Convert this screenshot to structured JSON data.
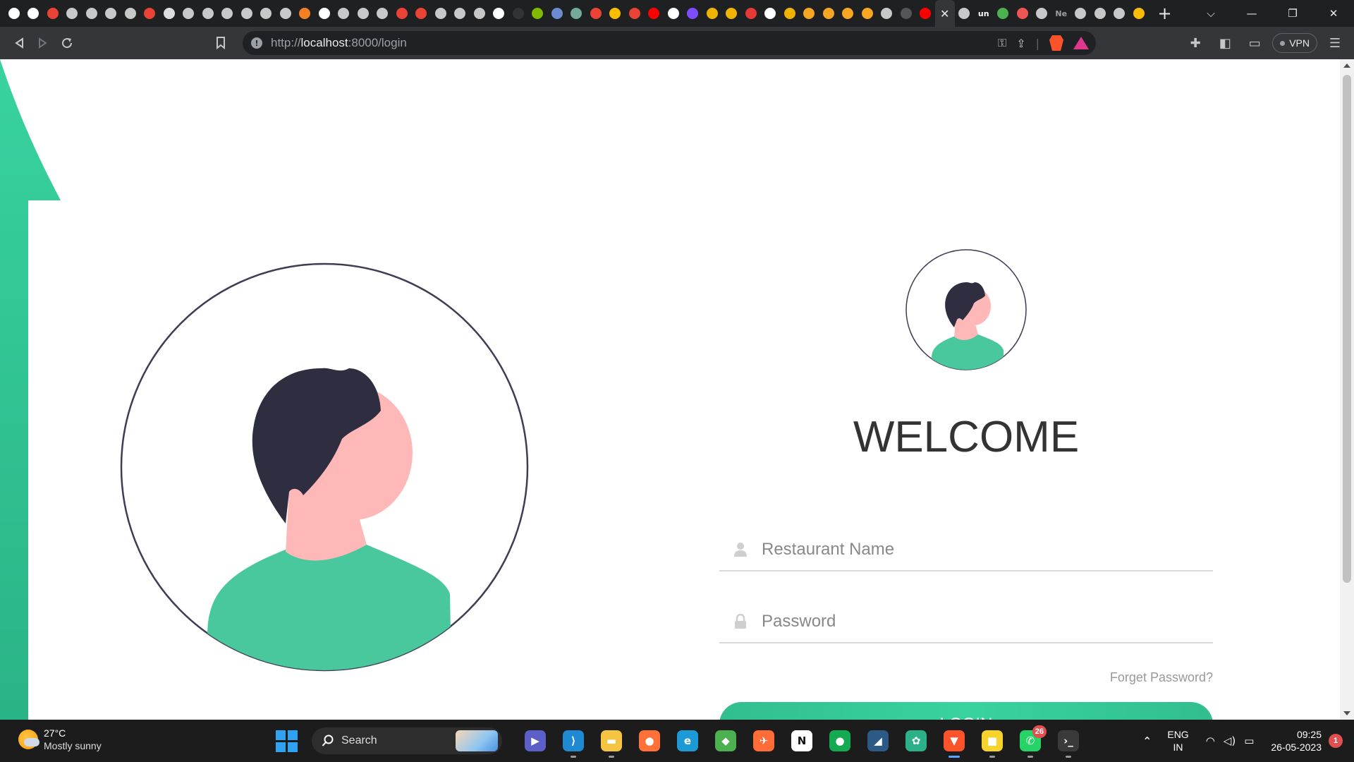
{
  "browser": {
    "tabs_favicons": [
      {
        "icon": "github-icon",
        "color": "#ffffff"
      },
      {
        "icon": "github-icon",
        "color": "#ffffff"
      },
      {
        "icon": "google-icon",
        "color": "#ea4335"
      },
      {
        "icon": "globe-icon",
        "color": "#c8c8c8"
      },
      {
        "icon": "globe-icon",
        "color": "#c8c8c8"
      },
      {
        "icon": "globe-icon",
        "color": "#c8c8c8"
      },
      {
        "icon": "globe-icon",
        "color": "#c8c8c8"
      },
      {
        "icon": "google-icon",
        "color": "#ea4335"
      },
      {
        "icon": "crown-icon",
        "color": "#dddddd"
      },
      {
        "icon": "globe-icon",
        "color": "#c8c8c8"
      },
      {
        "icon": "globe-icon",
        "color": "#c8c8c8"
      },
      {
        "icon": "globe-icon",
        "color": "#c8c8c8"
      },
      {
        "icon": "globe-icon",
        "color": "#c8c8c8"
      },
      {
        "icon": "globe-icon",
        "color": "#c8c8c8"
      },
      {
        "icon": "globe-icon",
        "color": "#c8c8c8"
      },
      {
        "icon": "stackoverflow-icon",
        "color": "#f48024"
      },
      {
        "icon": "github-icon",
        "color": "#ffffff"
      },
      {
        "icon": "globe-icon",
        "color": "#c8c8c8"
      },
      {
        "icon": "globe-icon",
        "color": "#c8c8c8"
      },
      {
        "icon": "globe-icon",
        "color": "#c8c8c8"
      },
      {
        "icon": "google-icon",
        "color": "#ea4335"
      },
      {
        "icon": "google-icon",
        "color": "#ea4335"
      },
      {
        "icon": "globe-icon",
        "color": "#c8c8c8"
      },
      {
        "icon": "globe-icon",
        "color": "#c8c8c8"
      },
      {
        "icon": "globe-icon",
        "color": "#c8c8c8"
      },
      {
        "icon": "github-icon",
        "color": "#ffffff"
      },
      {
        "icon": "dark-page-icon",
        "color": "#333333"
      },
      {
        "icon": "microsoft-icon",
        "color": "#7fba00"
      },
      {
        "icon": "image-icon",
        "color": "#6b8cce"
      },
      {
        "icon": "chatgpt-icon",
        "color": "#74aa9c"
      },
      {
        "icon": "google-icon",
        "color": "#ea4335"
      },
      {
        "icon": "drive-icon",
        "color": "#fbbc04"
      },
      {
        "icon": "google-icon",
        "color": "#ea4335"
      },
      {
        "icon": "youtube-icon",
        "color": "#ff0000"
      },
      {
        "icon": "history-icon",
        "color": "#ffffff"
      },
      {
        "icon": "list-icon",
        "color": "#7c4dff"
      },
      {
        "icon": "code-icon",
        "color": "#f0b400"
      },
      {
        "icon": "code-icon",
        "color": "#f0b400"
      },
      {
        "icon": "play-outline-icon",
        "color": "#e53935"
      },
      {
        "icon": "github-icon",
        "color": "#ffffff"
      },
      {
        "icon": "code-icon",
        "color": "#f0b400"
      },
      {
        "icon": "sun-icon",
        "color": "#f5a623"
      },
      {
        "icon": "sun-icon",
        "color": "#f5a623"
      },
      {
        "icon": "sun-icon",
        "color": "#f5a623"
      },
      {
        "icon": "sun-icon",
        "color": "#f5a623"
      },
      {
        "icon": "globe-icon",
        "color": "#c8c8c8"
      },
      {
        "icon": "circle-icon",
        "color": "#555555"
      },
      {
        "icon": "youtube-icon",
        "color": "#ff0000"
      },
      {
        "icon": "close-icon",
        "color": "#e8eaed",
        "active": true
      },
      {
        "icon": "globe-icon",
        "color": "#c8c8c8"
      },
      {
        "icon": "unstop-icon",
        "color": "#ffffff",
        "text": "un"
      },
      {
        "icon": "puzzle-icon",
        "color": "#4caf50"
      },
      {
        "icon": "figma-icon",
        "color": "#e55"
      },
      {
        "icon": "globe-icon",
        "color": "#c8c8c8"
      },
      {
        "icon": "notion-icon",
        "color": "#9aa0a6",
        "text": "Ne"
      },
      {
        "icon": "globe-icon",
        "color": "#c8c8c8"
      },
      {
        "icon": "globe-icon",
        "color": "#c8c8c8"
      },
      {
        "icon": "globe-icon",
        "color": "#c8c8c8"
      },
      {
        "icon": "slides-icon",
        "color": "#fbbc04"
      }
    ],
    "new_tab_label": "+",
    "window_controls": {
      "list": "⌵",
      "minimize": "—",
      "restore": "❐",
      "close": "✕"
    },
    "url_prefix": "http://",
    "url_host": "localhost",
    "url_rest": ":8000/login",
    "vpn_label": "VPN"
  },
  "page": {
    "welcome": "WELCOME",
    "username_placeholder": "Restaurant Name",
    "password_placeholder": "Password",
    "forgot_label": "Forget Password?",
    "login_label": "LOGIN",
    "colors": {
      "accent": "#38d39f",
      "accent_dark": "#32be8f",
      "hair": "#2f2e41",
      "skin": "#ffb8b8",
      "shirt": "#48c89c"
    }
  },
  "taskbar": {
    "weather_temp": "27°C",
    "weather_cond": "Mostly sunny",
    "search_label": "Search",
    "apps": [
      {
        "name": "teams-app",
        "icon": "teams-icon",
        "bg": "#5b5fc7",
        "glyph": "▶"
      },
      {
        "name": "vscode-app",
        "icon": "vscode-icon",
        "bg": "#1f8ad2",
        "glyph": "⟩",
        "pip": true
      },
      {
        "name": "explorer-app",
        "icon": "folder-icon",
        "bg": "#f5c542",
        "glyph": "▬",
        "pip": true
      },
      {
        "name": "firefox-app",
        "icon": "firefox-icon",
        "bg": "#ff7139",
        "glyph": "●"
      },
      {
        "name": "edge-app",
        "icon": "edge-icon",
        "bg": "#1c9ad6",
        "glyph": "e"
      },
      {
        "name": "git-app",
        "icon": "git-icon",
        "bg": "#4caf50",
        "glyph": "◆"
      },
      {
        "name": "postman-app",
        "icon": "postman-icon",
        "bg": "#ff6c37",
        "glyph": "✈"
      },
      {
        "name": "notion-app",
        "icon": "notion-icon",
        "bg": "#ffffff",
        "glyph": "N"
      },
      {
        "name": "mongodb-app",
        "icon": "mongodb-icon",
        "bg": "#13aa52",
        "glyph": "●"
      },
      {
        "name": "mysql-app",
        "icon": "mysql-icon",
        "bg": "#2c5a85",
        "glyph": "◢"
      },
      {
        "name": "chatgpt-app",
        "icon": "chatgpt-icon",
        "bg": "#2bb08a",
        "glyph": "✿"
      },
      {
        "name": "brave-app",
        "icon": "brave-icon",
        "bg": "#fb542b",
        "glyph": "▼",
        "pip": true,
        "active": true
      },
      {
        "name": "sticky-notes-app",
        "icon": "sticky-notes-icon",
        "bg": "#f7d32b",
        "glyph": "■",
        "pip": true
      },
      {
        "name": "whatsapp-app",
        "icon": "whatsapp-icon",
        "bg": "#25d366",
        "glyph": "✆",
        "badge": "26",
        "pip": true
      },
      {
        "name": "terminal-app",
        "icon": "terminal-icon",
        "bg": "#3a3a3a",
        "glyph": "›_",
        "pip": true
      }
    ],
    "lang_top": "ENG",
    "lang_bottom": "IN",
    "time": "09:25",
    "date": "26-05-2023",
    "notifications": "1"
  }
}
